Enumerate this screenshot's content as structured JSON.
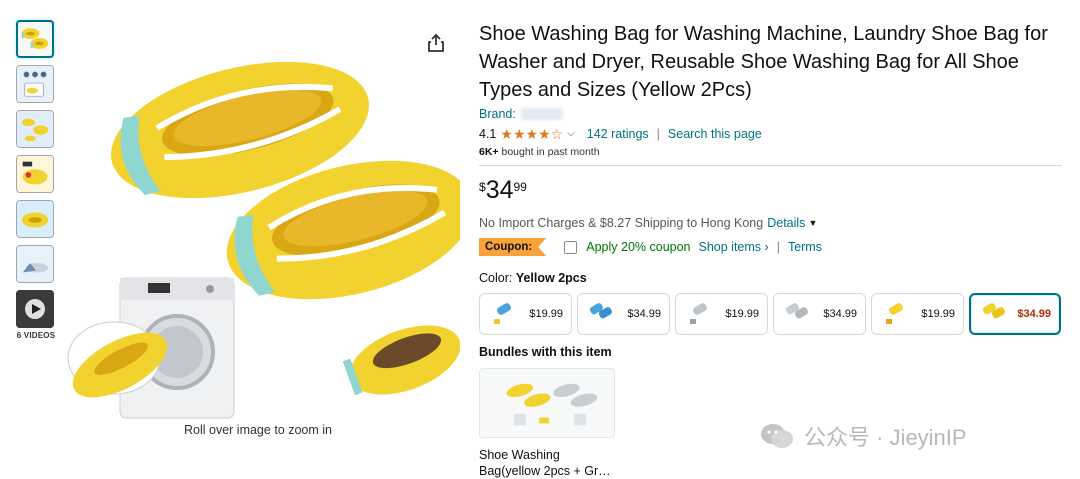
{
  "gallery": {
    "videos_label": "6 VIDEOS",
    "zoom_hint": "Roll over image to zoom in"
  },
  "product": {
    "title": "Shoe Washing Bag for Washing Machine, Laundry Shoe Bag for Washer and Dryer, Reusable Shoe Washing Bag for All Shoe Types and Sizes (Yellow 2Pcs)",
    "brand_label": "Brand:",
    "rating_value": "4.1",
    "rating_stars": 4.1,
    "ratings_count": "142 ratings",
    "search_page": "Search this page",
    "bought_bold": "6K+",
    "bought_text": " bought in past month"
  },
  "price": {
    "symbol": "$",
    "whole": "34",
    "fraction": "99"
  },
  "shipping": {
    "text": "No Import Charges & $8.27 Shipping to Hong Kong",
    "details_link": "Details"
  },
  "coupon": {
    "badge": "Coupon:",
    "apply_text": "Apply 20% coupon",
    "shop_items": "Shop items ›",
    "separator": "|",
    "terms": "Terms"
  },
  "color": {
    "label": "Color:",
    "selected": "Yellow 2pcs",
    "options": [
      {
        "price": "$19.99",
        "variant": "blue-1"
      },
      {
        "price": "$34.99",
        "variant": "blue-2"
      },
      {
        "price": "$19.99",
        "variant": "grey-1"
      },
      {
        "price": "$34.99",
        "variant": "grey-2"
      },
      {
        "price": "$19.99",
        "variant": "yellow-1"
      },
      {
        "price": "$34.99",
        "variant": "yellow-2"
      }
    ]
  },
  "bundles": {
    "title": "Bundles with this item",
    "item_name": "Shoe Washing Bag(yellow 2pcs + Gr…"
  },
  "watermark": {
    "text": "公众号 · JieyinIP"
  },
  "colors": {
    "link": "#007185",
    "star": "#de7921",
    "coupon_badge": "#f7a33a",
    "coupon_text": "#007600",
    "selected_price": "#b12704",
    "product_yellow": "#f2d22e",
    "product_teal": "#8fd6d0"
  }
}
